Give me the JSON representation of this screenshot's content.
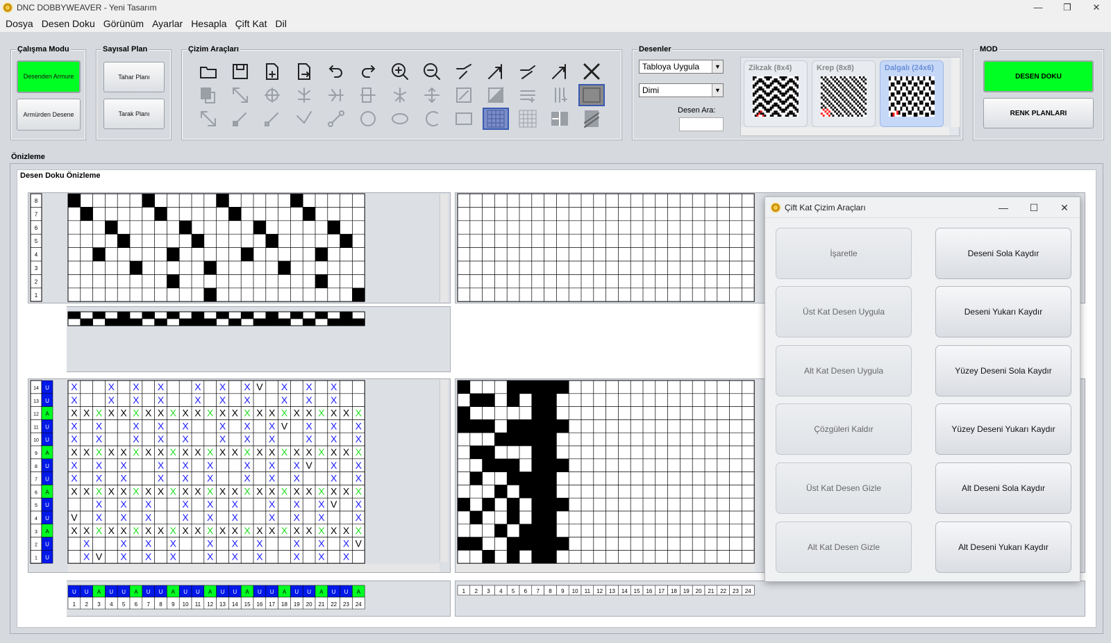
{
  "window": {
    "title": "DNC DOBBYWEAVER - Yeni Tasarım",
    "controls": [
      "—",
      "❐",
      "✕"
    ]
  },
  "menu": [
    "Dosya",
    "Desen Doku",
    "Görünüm",
    "Ayarlar",
    "Hesapla",
    "Çift Kat",
    "Dil"
  ],
  "calisma_modu": {
    "title": "Çalışma Modu",
    "btn1": "Desenden Armure",
    "btn2": "Armürden Desene"
  },
  "sayisal_plan": {
    "title": "Sayısal Plan",
    "btn1": "Tahar Planı",
    "btn2": "Tarak Planı"
  },
  "cizim": {
    "title": "Çizim Araçları",
    "tools": [
      "open-folder",
      "save",
      "new-doc",
      "export-doc",
      "undo",
      "redo",
      "zoom-in",
      "zoom-out",
      "align-left-up",
      "align-right-up",
      "arrow-left-up",
      "arrow-right-up",
      "clear-x",
      "copy",
      "resize",
      "rotate",
      "mirror-v",
      "mirror-h",
      "flip",
      "mirror-v2",
      "move",
      "fill",
      "fill-half",
      "insert-row",
      "insert-col",
      "rect-select",
      "select-cursor",
      "pencil",
      "line",
      "vline",
      "connect-line",
      "circle",
      "ellipse",
      "arc",
      "rectangle",
      "grid-fill",
      "grid",
      "split",
      "hatch"
    ]
  },
  "desenler": {
    "title": "Desenler",
    "combo1": "Tabloya Uygula",
    "combo2": "Dimi",
    "search_label": "Desen Ara:",
    "search_value": "",
    "thumbs": [
      {
        "label": "Zikzak (8x4)"
      },
      {
        "label": "Krep (8x8)"
      },
      {
        "label": "Dalgalı (24x6)"
      }
    ]
  },
  "mod": {
    "title": "MOD",
    "btn1": "DESEN DOKU",
    "btn2": "RENK PLANLARI"
  },
  "preview": {
    "title": "Önizleme",
    "inner_title": "Desen Doku Önizleme"
  },
  "armure": {
    "row_labels": [
      "8",
      "7",
      "6",
      "5",
      "4",
      "3",
      "2",
      "1"
    ]
  },
  "pattern": {
    "row_labels": [
      "14",
      "13",
      "12",
      "11",
      "10",
      "9",
      "8",
      "7",
      "6",
      "5",
      "4",
      "3",
      "2",
      "1"
    ],
    "row_flags": [
      "U",
      "U",
      "A",
      "U",
      "U",
      "A",
      "U",
      "U",
      "A",
      "U",
      "U",
      "A",
      "U",
      "U"
    ]
  },
  "bottom": {
    "flags": [
      "U",
      "U",
      "A",
      "U",
      "U",
      "A",
      "U",
      "U",
      "A",
      "U",
      "U",
      "A",
      "U",
      "U",
      "A",
      "U",
      "U",
      "A",
      "U",
      "U",
      "A",
      "U",
      "U",
      "A"
    ],
    "nums": [
      "1",
      "2",
      "3",
      "4",
      "5",
      "6",
      "7",
      "8",
      "9",
      "10",
      "11",
      "12",
      "13",
      "14",
      "15",
      "16",
      "17",
      "18",
      "19",
      "20",
      "21",
      "22",
      "23",
      "24"
    ]
  },
  "colors": {
    "green": "#00ff22",
    "blue": "#0018e8",
    "x_blue": "#1a1aff",
    "x_green": "#22dd22"
  },
  "dialog": {
    "title": "Çift Kat Çizim Araçları",
    "left": [
      "İşaretle",
      "Üst Kat Desen Uygula",
      "Alt Kat Desen Uygula",
      "Çözgüleri Kaldır",
      "Üst Kat Desen Gizle",
      "Alt Kat Desen Gizle"
    ],
    "right": [
      "Deseni Sola Kaydır",
      "Deseni Yukarı Kaydır",
      "Yüzey Deseni Sola Kaydır",
      "Yüzey Deseni Yukarı Kaydır",
      "Alt Deseni Sola Kaydır",
      "Alt Deseni Yukarı Kaydır"
    ]
  }
}
